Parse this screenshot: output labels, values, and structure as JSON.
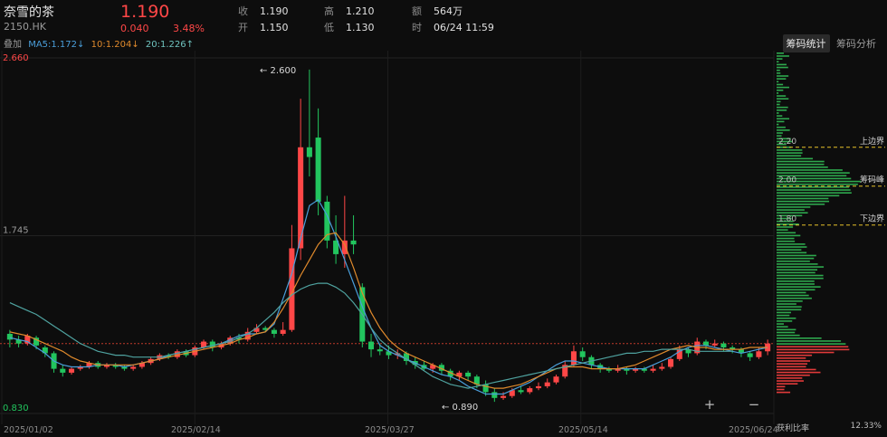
{
  "stock": {
    "name": "奈雪的茶",
    "code": "2150.HK",
    "price": "1.190",
    "change": "0.040",
    "change_pct": "3.48%"
  },
  "quote": {
    "close_label": "收",
    "close": "1.190",
    "open_label": "开",
    "open": "1.150",
    "high_label": "高",
    "high": "1.210",
    "low_label": "低",
    "low": "1.130",
    "amount_label": "额",
    "amount": "564万",
    "time_label": "时",
    "time": "06/24 11:59"
  },
  "ma": {
    "overlay_label": "叠加",
    "ma5": "MA5:1.172↓",
    "ma10": "10:1.204↓",
    "ma20": "20:1.226↑"
  },
  "tabs": [
    {
      "label": "筹码统计"
    },
    {
      "label": "筹码分析"
    }
  ],
  "axis": {
    "y_top": "2.660",
    "y_mid": "1.745",
    "y_bot": "0.830",
    "x_labels": [
      "2025/01/02",
      "2025/02/14",
      "2025/03/27",
      "2025/05/14",
      "2025/06/24"
    ]
  },
  "annotations": {
    "max_label": "2.600",
    "min_label": "0.890"
  },
  "chips": {
    "upper_label": "上边界",
    "peak_label": "筹码峰",
    "lower_label": "下边界",
    "upper_price": "2.20",
    "peak_price": "2.00",
    "lower_price": "1.80",
    "profit_label": "获利比率",
    "profit_value": "12.33%"
  },
  "zoom": {
    "plus": "+",
    "minus": "−"
  },
  "colors": {
    "up": "#ff4747",
    "down": "#22c55e",
    "ma5": "#4a9eda",
    "ma10": "#e08a2c",
    "ma20": "#4fa3a0"
  },
  "chart_data": {
    "type": "candlestick",
    "ylim": [
      0.83,
      2.66
    ],
    "candles": [
      [
        1.24,
        1.21,
        1.26,
        1.17
      ],
      [
        1.21,
        1.19,
        1.23,
        1.17
      ],
      [
        1.19,
        1.23,
        1.24,
        1.18
      ],
      [
        1.22,
        1.18,
        1.23,
        1.16
      ],
      [
        1.17,
        1.14,
        1.18,
        1.12
      ],
      [
        1.14,
        1.06,
        1.15,
        1.04
      ],
      [
        1.06,
        1.04,
        1.08,
        1.02
      ],
      [
        1.04,
        1.06,
        1.07,
        1.03
      ],
      [
        1.06,
        1.07,
        1.08,
        1.05
      ],
      [
        1.07,
        1.09,
        1.1,
        1.06
      ],
      [
        1.09,
        1.07,
        1.1,
        1.06
      ],
      [
        1.07,
        1.08,
        1.09,
        1.06
      ],
      [
        1.08,
        1.07,
        1.09,
        1.06
      ],
      [
        1.07,
        1.06,
        1.08,
        1.05
      ],
      [
        1.06,
        1.07,
        1.08,
        1.05
      ],
      [
        1.07,
        1.09,
        1.1,
        1.06
      ],
      [
        1.09,
        1.11,
        1.12,
        1.08
      ],
      [
        1.11,
        1.13,
        1.14,
        1.1
      ],
      [
        1.13,
        1.12,
        1.14,
        1.11
      ],
      [
        1.12,
        1.15,
        1.16,
        1.11
      ],
      [
        1.15,
        1.13,
        1.16,
        1.12
      ],
      [
        1.13,
        1.17,
        1.18,
        1.12
      ],
      [
        1.17,
        1.2,
        1.21,
        1.16
      ],
      [
        1.2,
        1.17,
        1.21,
        1.15
      ],
      [
        1.17,
        1.19,
        1.2,
        1.16
      ],
      [
        1.19,
        1.22,
        1.23,
        1.18
      ],
      [
        1.22,
        1.21,
        1.24,
        1.19
      ],
      [
        1.21,
        1.25,
        1.27,
        1.2
      ],
      [
        1.25,
        1.27,
        1.29,
        1.24
      ],
      [
        1.27,
        1.26,
        1.28,
        1.25
      ],
      [
        1.26,
        1.24,
        1.27,
        1.22
      ],
      [
        1.24,
        1.26,
        1.3,
        1.23
      ],
      [
        1.26,
        1.68,
        1.8,
        1.25
      ],
      [
        1.68,
        2.2,
        2.45,
        1.62
      ],
      [
        2.2,
        2.15,
        2.6,
        2.05
      ],
      [
        2.25,
        1.92,
        2.4,
        1.85
      ],
      [
        1.92,
        1.72,
        1.95,
        1.68
      ],
      [
        1.72,
        1.65,
        1.85,
        1.6
      ],
      [
        1.65,
        1.72,
        1.95,
        1.58
      ],
      [
        1.72,
        1.7,
        1.85,
        1.65
      ],
      [
        1.48,
        1.2,
        1.5,
        1.17
      ],
      [
        1.2,
        1.16,
        1.24,
        1.12
      ],
      [
        1.16,
        1.15,
        1.19,
        1.13
      ],
      [
        1.15,
        1.13,
        1.18,
        1.11
      ],
      [
        1.13,
        1.14,
        1.16,
        1.11
      ],
      [
        1.14,
        1.1,
        1.15,
        1.08
      ],
      [
        1.1,
        1.08,
        1.12,
        1.06
      ],
      [
        1.08,
        1.06,
        1.1,
        1.05
      ],
      [
        1.06,
        1.08,
        1.09,
        1.04
      ],
      [
        1.08,
        1.05,
        1.09,
        1.03
      ],
      [
        1.05,
        1.02,
        1.06,
        1.0
      ],
      [
        1.02,
        1.04,
        1.05,
        1.0
      ],
      [
        1.04,
        1.02,
        1.05,
        1.0
      ],
      [
        1.02,
        0.98,
        1.03,
        0.96
      ],
      [
        0.98,
        0.94,
        1.0,
        0.92
      ],
      [
        0.94,
        0.91,
        0.96,
        0.89
      ],
      [
        0.91,
        0.92,
        0.94,
        0.9
      ],
      [
        0.92,
        0.95,
        0.96,
        0.91
      ],
      [
        0.95,
        0.94,
        0.97,
        0.93
      ],
      [
        0.94,
        0.96,
        0.97,
        0.93
      ],
      [
        0.96,
        0.97,
        0.99,
        0.95
      ],
      [
        0.97,
        0.99,
        1.01,
        0.96
      ],
      [
        0.99,
        1.02,
        1.03,
        0.98
      ],
      [
        1.02,
        1.08,
        1.1,
        1.01
      ],
      [
        1.08,
        1.15,
        1.18,
        1.07
      ],
      [
        1.15,
        1.12,
        1.17,
        1.1
      ],
      [
        1.12,
        1.08,
        1.13,
        1.06
      ],
      [
        1.08,
        1.06,
        1.09,
        1.04
      ],
      [
        1.06,
        1.05,
        1.07,
        1.04
      ],
      [
        1.05,
        1.06,
        1.08,
        1.04
      ],
      [
        1.06,
        1.05,
        1.07,
        1.03
      ],
      [
        1.05,
        1.06,
        1.07,
        1.04
      ],
      [
        1.06,
        1.05,
        1.07,
        1.04
      ],
      [
        1.05,
        1.06,
        1.08,
        1.04
      ],
      [
        1.06,
        1.07,
        1.09,
        1.05
      ],
      [
        1.07,
        1.11,
        1.12,
        1.06
      ],
      [
        1.11,
        1.16,
        1.18,
        1.1
      ],
      [
        1.16,
        1.14,
        1.17,
        1.12
      ],
      [
        1.14,
        1.2,
        1.22,
        1.13
      ],
      [
        1.2,
        1.18,
        1.21,
        1.16
      ],
      [
        1.18,
        1.19,
        1.21,
        1.17
      ],
      [
        1.19,
        1.17,
        1.2,
        1.15
      ],
      [
        1.17,
        1.16,
        1.18,
        1.14
      ],
      [
        1.16,
        1.14,
        1.17,
        1.12
      ],
      [
        1.14,
        1.12,
        1.15,
        1.1
      ],
      [
        1.12,
        1.15,
        1.17,
        1.11
      ],
      [
        1.15,
        1.19,
        1.21,
        1.13
      ]
    ],
    "ma5": [
      1.22,
      1.21,
      1.2,
      1.17,
      1.14,
      1.1,
      1.08,
      1.07,
      1.07,
      1.07,
      1.08,
      1.08,
      1.08,
      1.07,
      1.08,
      1.09,
      1.1,
      1.11,
      1.13,
      1.14,
      1.15,
      1.16,
      1.17,
      1.18,
      1.19,
      1.21,
      1.23,
      1.24,
      1.24,
      1.25,
      1.29,
      1.42,
      1.55,
      1.73,
      1.9,
      1.93,
      1.85,
      1.74,
      1.62,
      1.5,
      1.38,
      1.27,
      1.18,
      1.15,
      1.13,
      1.11,
      1.09,
      1.07,
      1.05,
      1.03,
      1.02,
      1.0,
      0.97,
      0.95,
      0.93,
      0.93,
      0.93,
      0.95,
      0.97,
      0.99,
      1.02,
      1.05,
      1.08,
      1.1,
      1.1,
      1.09,
      1.08,
      1.07,
      1.06,
      1.06,
      1.06,
      1.06,
      1.06,
      1.08,
      1.1,
      1.12,
      1.15,
      1.17,
      1.18,
      1.18,
      1.17,
      1.16,
      1.15,
      1.14,
      1.15,
      1.16,
      1.17
    ],
    "ma10": [
      1.25,
      1.24,
      1.23,
      1.21,
      1.19,
      1.17,
      1.15,
      1.12,
      1.1,
      1.09,
      1.08,
      1.08,
      1.08,
      1.08,
      1.08,
      1.09,
      1.1,
      1.11,
      1.12,
      1.13,
      1.14,
      1.15,
      1.16,
      1.17,
      1.18,
      1.19,
      1.21,
      1.22,
      1.24,
      1.25,
      1.3,
      1.37,
      1.45,
      1.54,
      1.62,
      1.7,
      1.75,
      1.76,
      1.7,
      1.58,
      1.45,
      1.35,
      1.27,
      1.21,
      1.17,
      1.14,
      1.12,
      1.1,
      1.08,
      1.06,
      1.04,
      1.02,
      1.0,
      0.98,
      0.97,
      0.96,
      0.96,
      0.97,
      0.98,
      1.0,
      1.02,
      1.04,
      1.06,
      1.07,
      1.07,
      1.07,
      1.06,
      1.06,
      1.06,
      1.06,
      1.07,
      1.08,
      1.1,
      1.12,
      1.14,
      1.16,
      1.17,
      1.18,
      1.17,
      1.17,
      1.16,
      1.16,
      1.16,
      1.16,
      1.17,
      1.17,
      1.17
    ],
    "ma20": [
      1.4,
      1.38,
      1.36,
      1.34,
      1.31,
      1.28,
      1.25,
      1.22,
      1.19,
      1.17,
      1.15,
      1.14,
      1.13,
      1.13,
      1.12,
      1.12,
      1.12,
      1.12,
      1.13,
      1.14,
      1.15,
      1.16,
      1.17,
      1.18,
      1.19,
      1.2,
      1.22,
      1.24,
      1.27,
      1.31,
      1.35,
      1.4,
      1.44,
      1.47,
      1.49,
      1.5,
      1.5,
      1.48,
      1.45,
      1.4,
      1.34,
      1.27,
      1.21,
      1.17,
      1.14,
      1.11,
      1.08,
      1.05,
      1.02,
      1.0,
      0.98,
      0.97,
      0.96,
      0.97,
      0.98,
      0.99,
      1.0,
      1.01,
      1.02,
      1.03,
      1.04,
      1.05,
      1.06,
      1.07,
      1.08,
      1.09,
      1.1,
      1.11,
      1.12,
      1.13,
      1.14,
      1.14,
      1.15,
      1.15,
      1.16,
      1.16,
      1.16,
      1.16,
      1.15,
      1.15,
      1.15,
      1.15,
      1.15
    ]
  }
}
